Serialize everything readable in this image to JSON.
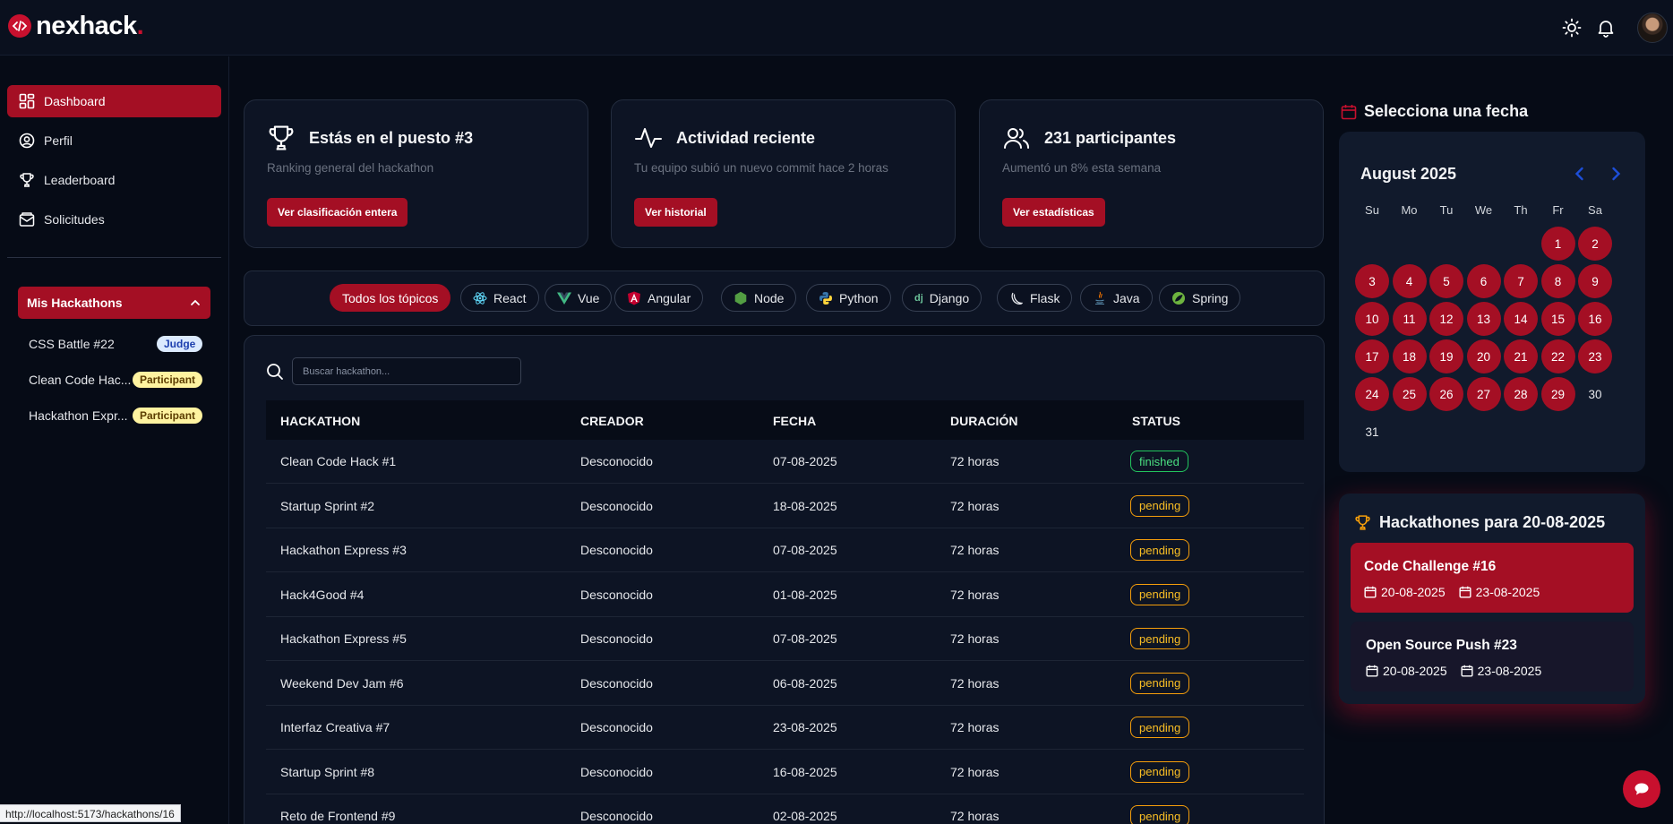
{
  "app": {
    "logo_text": "nexhack",
    "logo_dot": "."
  },
  "header": {
    "theme_icon": "sun-icon",
    "bell_icon": "bell-icon"
  },
  "sidebar": {
    "items": [
      {
        "label": "Dashboard",
        "icon": "dashboard-icon"
      },
      {
        "label": "Perfil",
        "icon": "user-circle-icon"
      },
      {
        "label": "Leaderboard",
        "icon": "trophy-icon"
      },
      {
        "label": "Solicitudes",
        "icon": "inbox-icon"
      }
    ],
    "my_hackathons": {
      "title": "Mis Hackathons",
      "items": [
        {
          "name": "CSS Battle #22",
          "role": "Judge"
        },
        {
          "name": "Clean Code Hac...",
          "role": "Participant"
        },
        {
          "name": "Hackathon Expr...",
          "role": "Participant"
        }
      ]
    }
  },
  "cards": [
    {
      "title": "Estás en el puesto #3",
      "subtitle": "Ranking general del hackathon",
      "button": "Ver clasificación entera",
      "icon": "trophy-icon"
    },
    {
      "title": "Actividad reciente",
      "subtitle": "Tu equipo subió un nuevo commit hace 2 horas",
      "button": "Ver historial",
      "icon": "activity-icon"
    },
    {
      "title": "231 participantes",
      "subtitle": "Aumentó un 8% esta semana",
      "button": "Ver estadísticas",
      "icon": "users-icon"
    }
  ],
  "topics": [
    {
      "label": "Todos los tópicos",
      "active": true
    },
    {
      "label": "React",
      "icon": "react-icon"
    },
    {
      "label": "Vue",
      "icon": "vue-icon"
    },
    {
      "label": "Angular",
      "icon": "angular-icon"
    },
    {
      "label": "Node",
      "icon": "node-icon"
    },
    {
      "label": "Python",
      "icon": "python-icon"
    },
    {
      "label": "Django",
      "icon": "django-icon"
    },
    {
      "label": "Flask",
      "icon": "flask-icon"
    },
    {
      "label": "Java",
      "icon": "java-icon"
    },
    {
      "label": "Spring",
      "icon": "spring-icon"
    }
  ],
  "search": {
    "placeholder": "Buscar hackathon..."
  },
  "table": {
    "columns": [
      "HACKATHON",
      "CREADOR",
      "FECHA",
      "DURACIÓN",
      "STATUS"
    ],
    "rows": [
      {
        "name": "Clean Code Hack #1",
        "creator": "Desconocido",
        "date": "07-08-2025",
        "duration": "72 horas",
        "status": "finished"
      },
      {
        "name": "Startup Sprint #2",
        "creator": "Desconocido",
        "date": "18-08-2025",
        "duration": "72 horas",
        "status": "pending"
      },
      {
        "name": "Hackathon Express #3",
        "creator": "Desconocido",
        "date": "07-08-2025",
        "duration": "72 horas",
        "status": "pending"
      },
      {
        "name": "Hack4Good #4",
        "creator": "Desconocido",
        "date": "01-08-2025",
        "duration": "72 horas",
        "status": "pending"
      },
      {
        "name": "Hackathon Express #5",
        "creator": "Desconocido",
        "date": "07-08-2025",
        "duration": "72 horas",
        "status": "pending"
      },
      {
        "name": "Weekend Dev Jam #6",
        "creator": "Desconocido",
        "date": "06-08-2025",
        "duration": "72 horas",
        "status": "pending"
      },
      {
        "name": "Interfaz Creativa #7",
        "creator": "Desconocido",
        "date": "23-08-2025",
        "duration": "72 horas",
        "status": "pending"
      },
      {
        "name": "Startup Sprint #8",
        "creator": "Desconocido",
        "date": "16-08-2025",
        "duration": "72 horas",
        "status": "pending"
      },
      {
        "name": "Reto de Frontend #9",
        "creator": "Desconocido",
        "date": "02-08-2025",
        "duration": "72 horas",
        "status": "pending"
      }
    ]
  },
  "calendar": {
    "title": "Selecciona una fecha",
    "month": "August 2025",
    "weekdays": [
      "Su",
      "Mo",
      "Tu",
      "We",
      "Th",
      "Fr",
      "Sa"
    ],
    "first_weekday": 5,
    "days": 31,
    "highlighted_days": [
      1,
      2,
      3,
      4,
      5,
      6,
      7,
      8,
      9,
      10,
      11,
      12,
      13,
      14,
      15,
      16,
      17,
      18,
      19,
      20,
      21,
      22,
      23,
      24,
      25,
      26,
      27,
      28,
      29
    ]
  },
  "events": {
    "title": "Hackathones para 20-08-2025",
    "items": [
      {
        "name": "Code Challenge #16",
        "start": "20-08-2025",
        "end": "23-08-2025",
        "active": true
      },
      {
        "name": "Open Source Push #23",
        "start": "20-08-2025",
        "end": "23-08-2025",
        "active": false
      }
    ]
  },
  "statusbar": {
    "url": "http://localhost:5173/hackathons/16"
  },
  "colors": {
    "accent": "#a40f24",
    "brand": "#c8102e",
    "background": "#060b16",
    "panel": "#0d1424",
    "finished": "#22c55e",
    "pending": "#f59e0b"
  }
}
